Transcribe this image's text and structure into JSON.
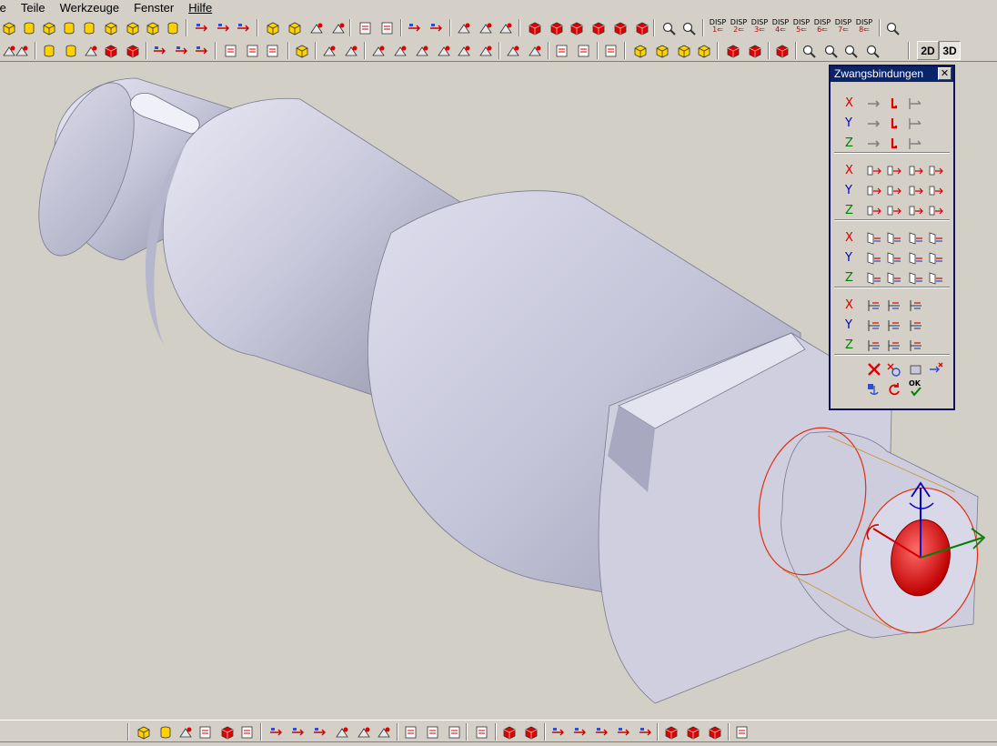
{
  "menubar": {
    "items": [
      {
        "label": "te",
        "underlined": false
      },
      {
        "label": "Teile",
        "underlined": false
      },
      {
        "label": "Werkzeuge",
        "underlined": false
      },
      {
        "label": "Fenster",
        "underlined": false
      },
      {
        "label": "Hilfe",
        "underlined": true
      }
    ]
  },
  "toolbar1": {
    "disp_buttons": [
      {
        "label": "DISP",
        "num": "1"
      },
      {
        "label": "DISP",
        "num": "2"
      },
      {
        "label": "DISP",
        "num": "3"
      },
      {
        "label": "DISP",
        "num": "4"
      },
      {
        "label": "DISP",
        "num": "5"
      },
      {
        "label": "DISP",
        "num": "6"
      },
      {
        "label": "DISP",
        "num": "7"
      },
      {
        "label": "DISP",
        "num": "8"
      }
    ]
  },
  "toolbar2": {
    "view_2d": "2D",
    "view_3d": "3D",
    "active_view": "3D"
  },
  "constraint_panel": {
    "title": "Zwangsbindungen",
    "close_label": "✕",
    "groups": [
      {
        "rows": [
          {
            "axis": "X"
          },
          {
            "axis": "Y"
          },
          {
            "axis": "Z"
          }
        ],
        "buttons_per_row": 3,
        "icon": "translation-constraint-icon"
      },
      {
        "rows": [
          {
            "axis": "X"
          },
          {
            "axis": "Y"
          },
          {
            "axis": "Z"
          }
        ],
        "buttons_per_row": 4,
        "icon": "plane-distance-icon"
      },
      {
        "rows": [
          {
            "axis": "X"
          },
          {
            "axis": "Y"
          },
          {
            "axis": "Z"
          }
        ],
        "buttons_per_row": 4,
        "icon": "face-alignment-icon"
      },
      {
        "rows": [
          {
            "axis": "X"
          },
          {
            "axis": "Y"
          },
          {
            "axis": "Z"
          }
        ],
        "buttons_per_row": 3,
        "icon": "axis-alignment-icon"
      }
    ],
    "ok_label": "OK"
  },
  "colors": {
    "axis_x": "#d00000",
    "axis_y": "#0000c0",
    "axis_z": "#008000",
    "title_bar": "#0a246a",
    "model_face": "#c8c8dc",
    "selection": "#e03010"
  }
}
